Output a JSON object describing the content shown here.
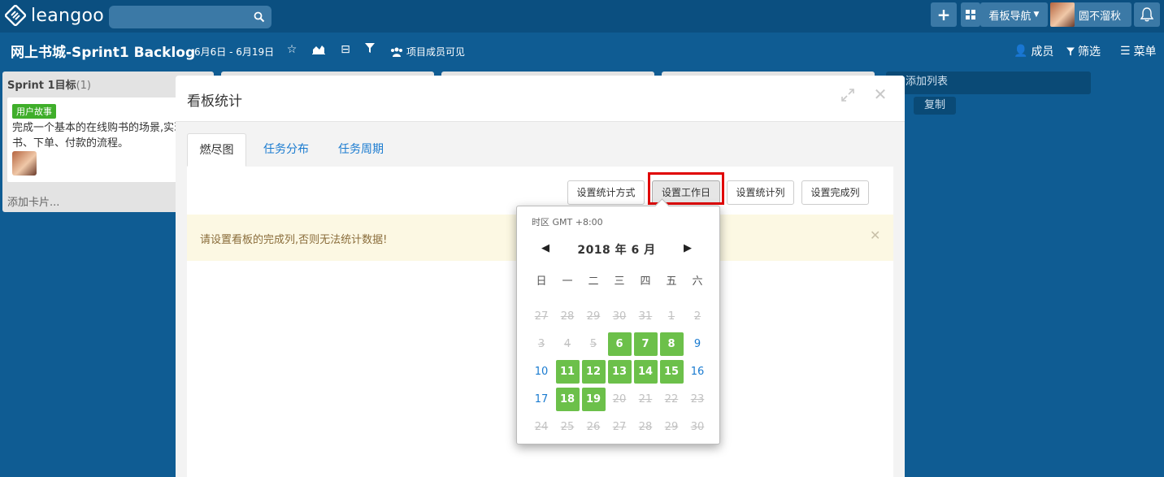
{
  "topbar": {
    "logo_text": "leangoo",
    "search_placeholder": "",
    "board_nav_label": "看板导航",
    "user_name": "圆不溜秋",
    "plus_label": "+"
  },
  "board": {
    "title": "网上书城-Sprint1 Backlog",
    "dates": "6月6日 - 6月19日",
    "visibility": "项目成员可见",
    "members_label": "成员",
    "filter_label": "筛选",
    "menu_label": "菜单"
  },
  "list": {
    "title": "Sprint 1目标",
    "count": "(1)",
    "card_tag": "用户故事",
    "card_text": "完成一个基本的在线购书的场景,实现找书、下单、付款的流程。",
    "add_card": "添加卡片...",
    "add_list": "添加列表",
    "copy": "复制"
  },
  "modal": {
    "title": "看板统计",
    "tabs": [
      {
        "label": "燃尽图"
      },
      {
        "label": "任务分布"
      },
      {
        "label": "任务周期"
      }
    ],
    "buttons": {
      "method": "设置统计方式",
      "workday": "设置工作日",
      "stat_col": "设置统计列",
      "done_col": "设置完成列"
    },
    "alert": "请设置看板的完成列,否则无法统计数据!"
  },
  "picker": {
    "timezone": "时区 GMT +8:00",
    "month_label": "2018 年 6 月",
    "weekdays": [
      "日",
      "一",
      "二",
      "三",
      "四",
      "五",
      "六"
    ],
    "weeks": [
      [
        {
          "d": "27",
          "s": "dis"
        },
        {
          "d": "28",
          "s": "dis"
        },
        {
          "d": "29",
          "s": "dis"
        },
        {
          "d": "30",
          "s": "dis"
        },
        {
          "d": "31",
          "s": "dis"
        },
        {
          "d": "1",
          "s": "dis"
        },
        {
          "d": "2",
          "s": "dis"
        }
      ],
      [
        {
          "d": "3",
          "s": "dis"
        },
        {
          "d": "4",
          "s": "dis"
        },
        {
          "d": "5",
          "s": "dis"
        },
        {
          "d": "6",
          "s": "sel"
        },
        {
          "d": "7",
          "s": "sel"
        },
        {
          "d": "8",
          "s": "sel"
        },
        {
          "d": "9",
          "s": "avail"
        }
      ],
      [
        {
          "d": "10",
          "s": "avail"
        },
        {
          "d": "11",
          "s": "sel"
        },
        {
          "d": "12",
          "s": "sel"
        },
        {
          "d": "13",
          "s": "sel"
        },
        {
          "d": "14",
          "s": "sel"
        },
        {
          "d": "15",
          "s": "sel"
        },
        {
          "d": "16",
          "s": "avail"
        }
      ],
      [
        {
          "d": "17",
          "s": "avail"
        },
        {
          "d": "18",
          "s": "sel"
        },
        {
          "d": "19",
          "s": "sel"
        },
        {
          "d": "20",
          "s": "dis"
        },
        {
          "d": "21",
          "s": "dis"
        },
        {
          "d": "22",
          "s": "dis"
        },
        {
          "d": "23",
          "s": "dis"
        }
      ],
      [
        {
          "d": "24",
          "s": "dis"
        },
        {
          "d": "25",
          "s": "dis"
        },
        {
          "d": "26",
          "s": "dis"
        },
        {
          "d": "27",
          "s": "dis"
        },
        {
          "d": "28",
          "s": "dis"
        },
        {
          "d": "29",
          "s": "dis"
        },
        {
          "d": "30",
          "s": "dis"
        }
      ]
    ]
  },
  "colors": {
    "nav_bg": "#0b4f80",
    "board_bg": "#0f5c93",
    "selected_day": "#6cc04a",
    "highlight": "#e00000"
  }
}
